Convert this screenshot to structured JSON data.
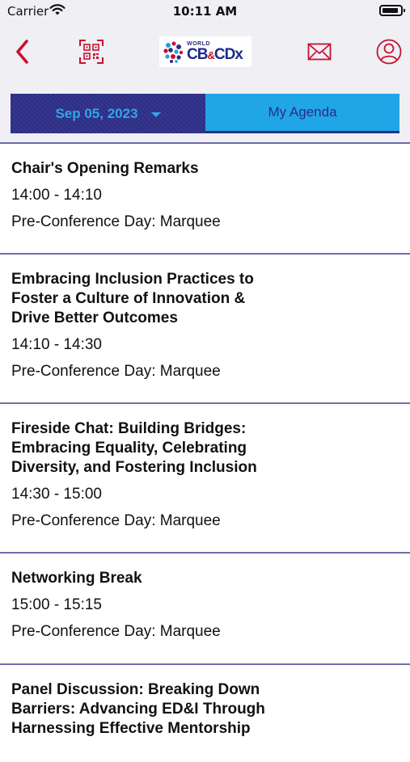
{
  "status_bar": {
    "carrier": "Carrier",
    "time": "10:11 AM"
  },
  "nav": {
    "back_icon": "chevron-left-icon",
    "scan_icon": "qr-scan-icon",
    "mail_icon": "mail-icon",
    "profile_icon": "user-icon",
    "logo": {
      "small": "WORLD",
      "big_1": "CB",
      "amp": "&",
      "big_2": "CDx"
    }
  },
  "tabs": {
    "date": "Sep 05, 2023",
    "agenda": "My Agenda"
  },
  "sessions": [
    {
      "title": "Chair's Opening Remarks",
      "time": "14:00 - 14:10",
      "location": "Pre-Conference Day: Marquee"
    },
    {
      "title": "Embracing Inclusion Practices to Foster a Culture of Innovation & Drive Better Outcomes",
      "time": "14:10 - 14:30",
      "location": "Pre-Conference Day: Marquee"
    },
    {
      "title": "Fireside Chat: Building Bridges: Embracing Equality, Celebrating Diversity, and Fostering Inclusion",
      "time": "14:30 - 15:00",
      "location": "Pre-Conference Day: Marquee"
    },
    {
      "title": "Networking Break",
      "time": "15:00 - 15:15",
      "location": "Pre-Conference Day: Marquee"
    },
    {
      "title": "Panel Discussion: Breaking Down Barriers: Advancing ED&I Through Harnessing Effective Mentorship",
      "time": "",
      "location": ""
    }
  ],
  "colors": {
    "accent_red": "#c8102e",
    "navy": "#2c2d86",
    "sky_blue": "#20a5e7"
  }
}
